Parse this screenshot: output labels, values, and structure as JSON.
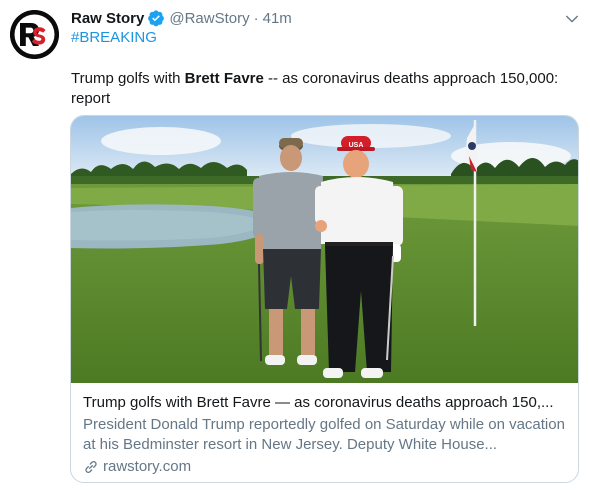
{
  "author": {
    "avatar_text": "RS",
    "name": "Raw Story",
    "handle": "@RawStory",
    "separator": "·",
    "time": "41m"
  },
  "hashtag": "#BREAKING",
  "tweet": {
    "text_before": "Trump golfs with ",
    "text_bold": "Brett Favre",
    "text_after": " -- as coronavirus deaths approach 150,000: report"
  },
  "card": {
    "title": "Trump golfs with Brett Favre — as coronavirus deaths approach 150,...",
    "description": "President Donald Trump reportedly golfed on Saturday while on vacation at his Bedminster resort in New Jersey. Deputy White House...",
    "domain": "rawstory.com",
    "image_cap_text": "USA"
  },
  "icons": {
    "verified": "verified-badge-icon",
    "caret": "chevron-down-icon",
    "link": "link-icon"
  },
  "colors": {
    "accent": "#1b95e0",
    "secondary_text": "#657786",
    "brand_red": "#d4212a"
  }
}
